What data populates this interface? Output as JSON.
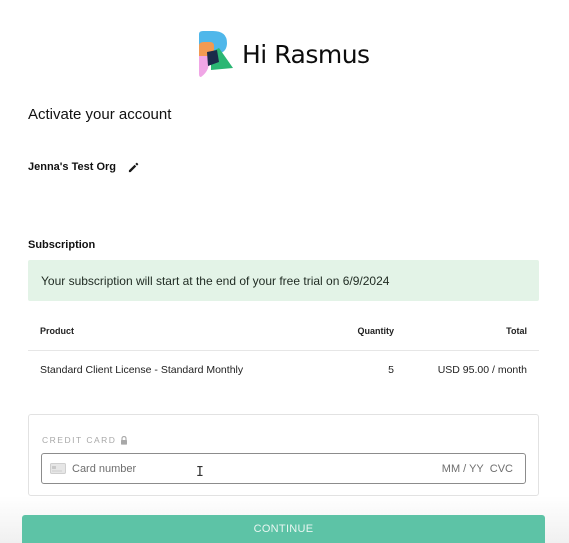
{
  "brand": {
    "name": "Hi Rasmus",
    "logo_icon": "rasmus-r-logo-icon"
  },
  "page": {
    "title": "Activate your account"
  },
  "organization": {
    "name": "Jenna's Test Org",
    "edit_icon": "pencil-icon"
  },
  "subscription": {
    "heading": "Subscription",
    "trial_notice": "Your subscription will start at the end of your free trial on 6/9/2024",
    "columns": {
      "product": "Product",
      "quantity": "Quantity",
      "total": "Total"
    },
    "rows": [
      {
        "product": "Standard Client License - Standard Monthly",
        "quantity": "5",
        "total": "USD 95.00 / month"
      }
    ]
  },
  "payment": {
    "label": "CREDIT CARD",
    "lock_icon": "lock-icon",
    "card_icon": "credit-card-icon",
    "card_number_placeholder": "Card number",
    "expiry_placeholder": "MM / YY",
    "cvc_placeholder": "CVC"
  },
  "actions": {
    "continue_label": "CONTINUE"
  },
  "colors": {
    "accent": "#5dc3a6",
    "banner_bg": "#e3f3e7",
    "logo_blue": "#4fb7ea",
    "logo_orange": "#f29a52",
    "logo_pink": "#f0a6e6",
    "logo_green": "#2bb673",
    "logo_navy": "#1b2a4a"
  }
}
